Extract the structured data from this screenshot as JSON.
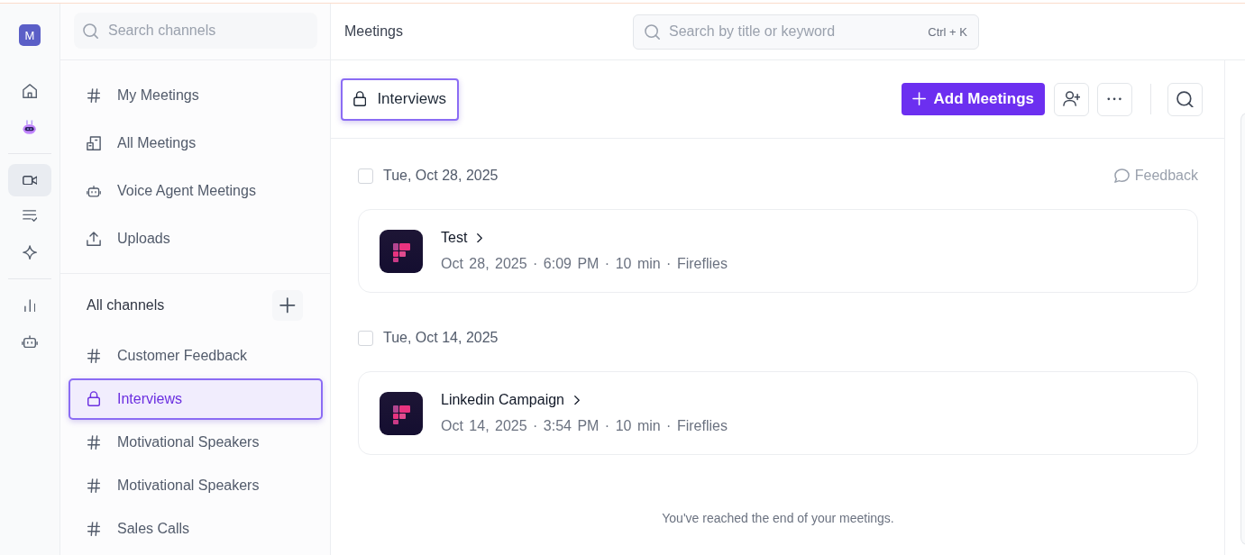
{
  "rail": {
    "avatar": "M",
    "groups": [
      [
        {
          "kind": "home",
          "selected": false
        },
        {
          "kind": "assistant",
          "selected": false
        }
      ],
      [
        {
          "kind": "video",
          "selected": true
        },
        {
          "kind": "tasks",
          "selected": false
        },
        {
          "kind": "sparkle",
          "selected": false
        }
      ],
      [
        {
          "kind": "analytics",
          "selected": false
        },
        {
          "kind": "robot",
          "selected": false
        }
      ]
    ]
  },
  "sidebar": {
    "search": {
      "placeholder": "Search channels"
    },
    "nav": [
      {
        "kind": "hash",
        "label": "My Meetings",
        "selected": false
      },
      {
        "kind": "building",
        "label": "All Meetings",
        "selected": false
      },
      {
        "kind": "robot",
        "label": "Voice Agent Meetings",
        "selected": false
      },
      {
        "kind": "upload",
        "label": "Uploads",
        "selected": false
      }
    ],
    "channels_heading": "All channels",
    "channels": [
      {
        "kind": "hash",
        "label": "Customer Feedback",
        "selected": false
      },
      {
        "kind": "lock",
        "label": "Interviews",
        "selected": true
      },
      {
        "kind": "hash",
        "label": "Motivational Speakers",
        "selected": false
      },
      {
        "kind": "hash",
        "label": "Motivational Speakers",
        "selected": false
      },
      {
        "kind": "hash",
        "label": "Sales Calls",
        "selected": false
      }
    ]
  },
  "header": {
    "title": "Meetings",
    "search": {
      "placeholder": "Search by title or keyword",
      "shortcut": "Ctrl + K"
    }
  },
  "channel_bar": {
    "title": {
      "kind": "lock",
      "label": "Interviews",
      "highlighted": true
    },
    "add_button": "Add Meetings"
  },
  "meeting_groups": [
    {
      "date": "Tue, Oct 28, 2025",
      "checked": false,
      "feedback_link": "Feedback",
      "meetings": [
        {
          "title": "Test",
          "meta": "Oct 28, 2025 · 6:09 PM · 10 min · Fireflies"
        }
      ]
    },
    {
      "date": "Tue, Oct 14, 2025",
      "checked": false,
      "meetings": [
        {
          "title": "Linkedin Campaign",
          "meta": "Oct 14, 2025 · 3:54 PM · 10 min · Fireflies"
        }
      ]
    }
  ],
  "end_note": "You've reached the end of your meetings."
}
